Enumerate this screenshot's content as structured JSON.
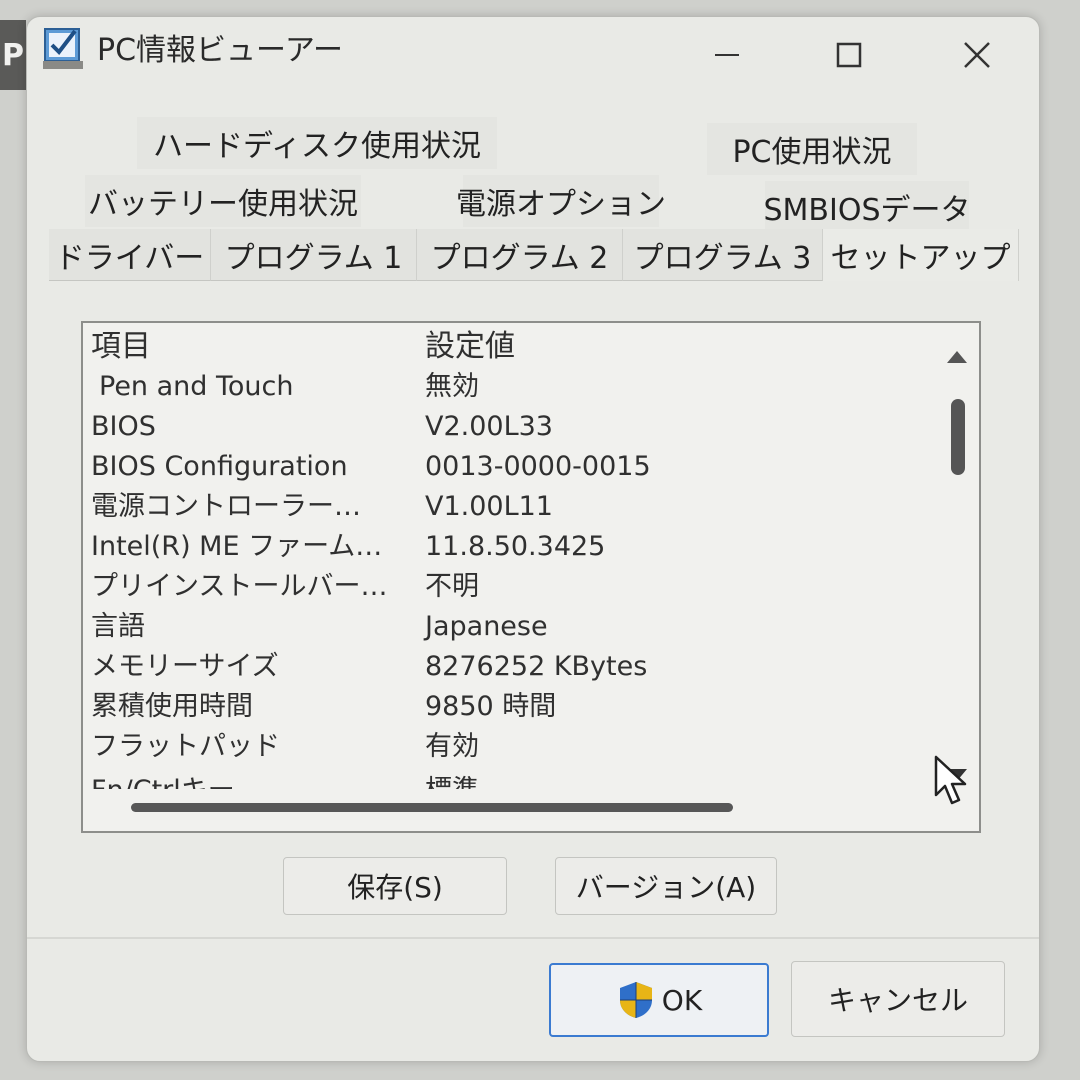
{
  "background_window": {
    "letter": "P"
  },
  "window": {
    "title": "PC情報ビューアー",
    "icon": "app-checkbox-icon",
    "controls": {
      "minimize": "minimize-icon",
      "maximize": "maximize-icon",
      "close": "close-icon"
    }
  },
  "tabs": {
    "row1": [
      "ハードディスク使用状況",
      "PC使用状況"
    ],
    "row2": [
      "バッテリー使用状況",
      "電源オプション",
      "SMBIOSデータ"
    ],
    "row3": [
      "ドライバー",
      "プログラム 1",
      "プログラム 2",
      "プログラム 3",
      "セットアップ"
    ]
  },
  "list": {
    "header": {
      "item": "項目",
      "value": "設定値"
    },
    "rows": [
      {
        "item": "Pen and Touch",
        "value": "無効"
      },
      {
        "item": "BIOS",
        "value": "V2.00L33"
      },
      {
        "item": "BIOS Configuration",
        "value": "0013-0000-0015"
      },
      {
        "item": "電源コントローラー…",
        "value": "V1.00L11"
      },
      {
        "item": "Intel(R) ME ファーム…",
        "value": "11.8.50.3425"
      },
      {
        "item": "プリインストールバー…",
        "value": "不明"
      },
      {
        "item": "言語",
        "value": "Japanese"
      },
      {
        "item": "メモリーサイズ",
        "value": "8276252 KBytes"
      },
      {
        "item": "累積使用時間",
        "value": "9850 時間"
      },
      {
        "item": "フラットパッド",
        "value": "有効"
      },
      {
        "item": "Fn/Ctrlキー",
        "value": "標準"
      }
    ]
  },
  "buttons": {
    "save": "保存(S)",
    "version": "バージョン(A)",
    "ok": "OK",
    "ok_icon": "uac-shield-icon",
    "cancel": "キャンセル"
  },
  "colors": {
    "window_bg": "#e9eae6",
    "list_bg": "#f1f1ee",
    "ok_border": "#3b7bd1",
    "shield_blue": "#2f6fc9",
    "shield_yellow": "#e8b516"
  }
}
